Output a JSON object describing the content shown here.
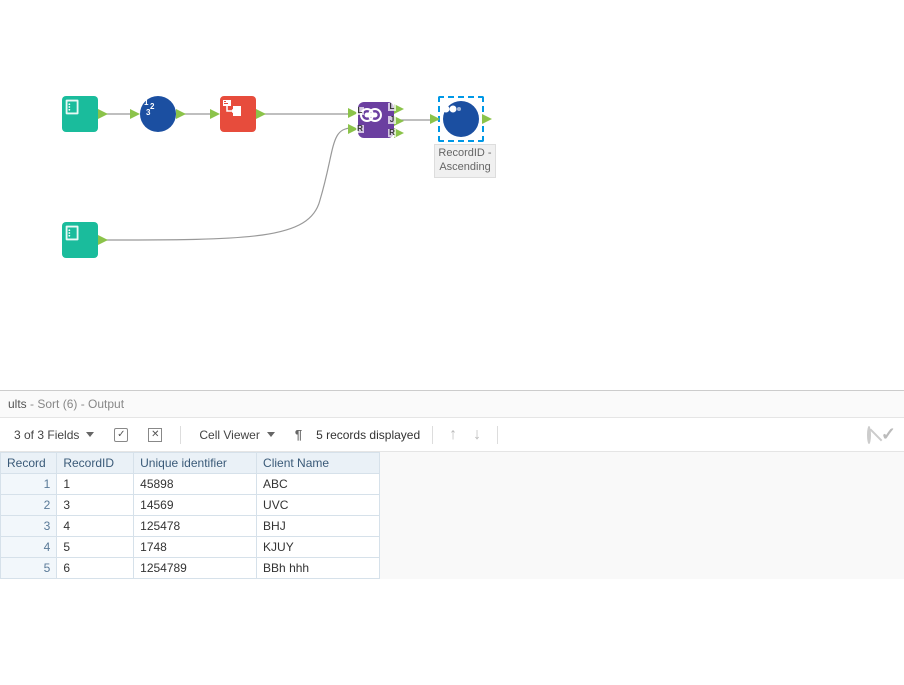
{
  "workflow": {
    "nodes": {
      "input1": {
        "type": "Input Data"
      },
      "recordid": {
        "type": "Record ID"
      },
      "summarize": {
        "type": "Summarize"
      },
      "input2": {
        "type": "Input Data"
      },
      "join": {
        "type": "Join",
        "ports_left": [
          "L",
          "R"
        ],
        "ports_right": [
          "L",
          "J",
          "R"
        ]
      },
      "sort": {
        "type": "Sort",
        "label_line1": "RecordID -",
        "label_line2": "Ascending"
      }
    }
  },
  "results": {
    "header_prefix": "ults",
    "header_sort": " - Sort (6) - ",
    "header_output": "Output",
    "toolbar": {
      "fields_label": "3 of 3 Fields",
      "cell_viewer_label": "Cell Viewer",
      "records_displayed": "5 records displayed"
    },
    "columns": [
      "Record",
      "RecordID",
      "Unique identifier",
      "Client Name"
    ],
    "rows": [
      {
        "n": "1",
        "RecordID": "1",
        "Unique identifier": "45898",
        "Client Name": "ABC"
      },
      {
        "n": "2",
        "RecordID": "3",
        "Unique identifier": "14569",
        "Client Name": "UVC"
      },
      {
        "n": "3",
        "RecordID": "4",
        "Unique identifier": "125478",
        "Client Name": "BHJ"
      },
      {
        "n": "4",
        "RecordID": "5",
        "Unique identifier": "1748",
        "Client Name": "KJUY"
      },
      {
        "n": "5",
        "RecordID": "6",
        "Unique identifier": "1254789",
        "Client Name": "BBh hhh"
      }
    ]
  }
}
